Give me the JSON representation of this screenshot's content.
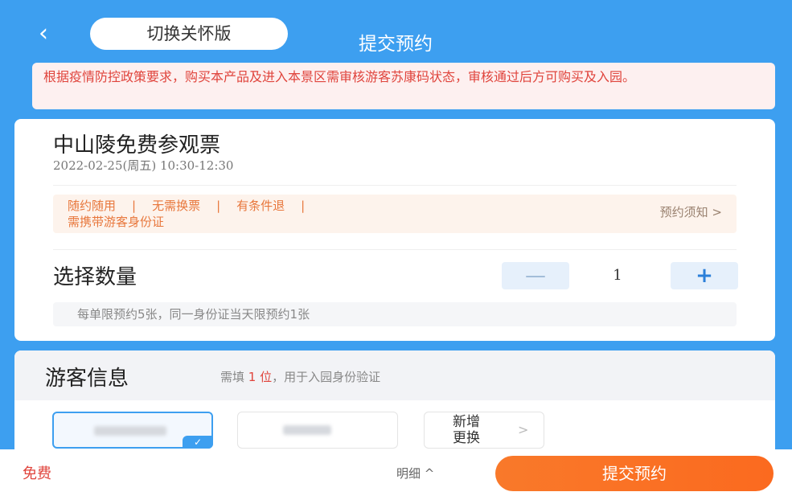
{
  "header": {
    "back_icon": "‹",
    "care_mode_label": "切换关怀版",
    "title": "提交预约"
  },
  "notice": {
    "text": "根据疫情防控政策要求，购买本产品及进入本景区需审核游客苏康码状态，审核通过后方可购买及入园。"
  },
  "ticket": {
    "name": "中山陵免费参观票",
    "datetime": "2022-02-25(周五) 10:30-12:30",
    "tags": [
      "随约随用",
      "无需换票",
      "有条件退",
      "需携带游客身份证"
    ],
    "notice_link": "预约须知 >"
  },
  "quantity": {
    "label": "选择数量",
    "minus": "—",
    "value": "1",
    "plus": "+",
    "limit_note": "每单限预约5张，同一身份证当天限预约1张"
  },
  "visitor": {
    "title": "游客信息",
    "hint_prefix": "需填",
    "hint_count": "1 位",
    "hint_suffix": "，用于入园身份验证",
    "add_label": "新增更换",
    "add_chevron": ">",
    "check_icon": "✓"
  },
  "footer": {
    "price": "免费",
    "detail_label": "明细 ^",
    "submit_label": "提交预约"
  },
  "colors": {
    "primary": "#3d9ff0",
    "accent_orange": "#f9792a",
    "warning_red": "#e0443c"
  }
}
